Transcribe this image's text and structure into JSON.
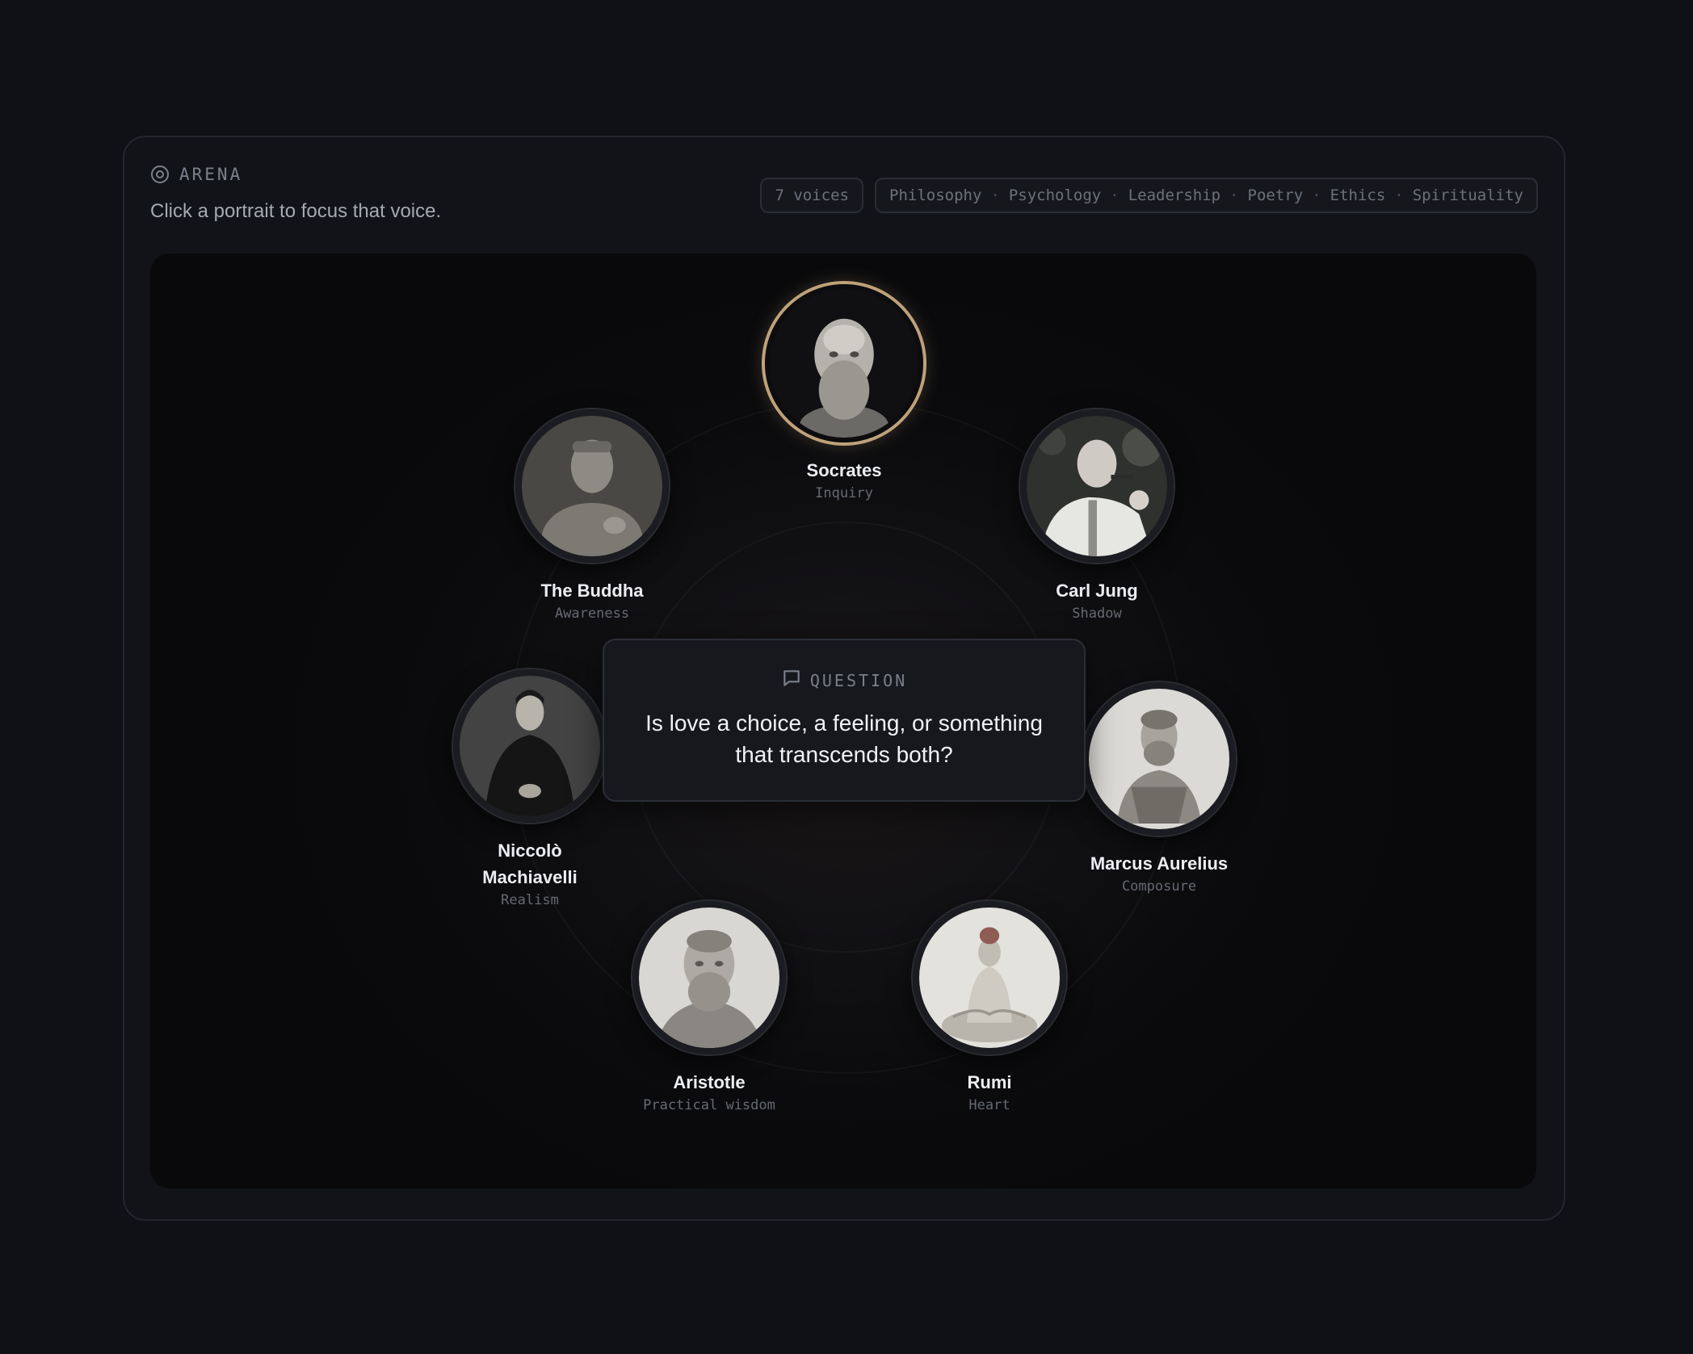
{
  "header": {
    "section_label": "ARENA",
    "subtitle": "Click a portrait to focus that voice.",
    "voice_count": "7 voices",
    "topics": [
      "Philosophy",
      "Psychology",
      "Leadership",
      "Poetry",
      "Ethics",
      "Spirituality"
    ]
  },
  "question": {
    "label": "QUESTION",
    "text": "Is love a choice, a feeling, or something that transcends both?"
  },
  "voices": [
    {
      "name": "Socrates",
      "trait": "Inquiry",
      "focused": true
    },
    {
      "name": "Carl Jung",
      "trait": "Shadow"
    },
    {
      "name": "Marcus Aurelius",
      "trait": "Composure"
    },
    {
      "name": "Rumi",
      "trait": "Heart"
    },
    {
      "name": "Aristotle",
      "trait": "Practical wisdom"
    },
    {
      "name": "Niccolò Machiavelli",
      "trait": "Realism"
    },
    {
      "name": "The Buddha",
      "trait": "Awareness"
    }
  ],
  "colors": {
    "page_bg": "#0f1116",
    "focus_ring": "#bfa27a",
    "text_primary": "#eceef1",
    "text_muted": "#656a73"
  },
  "icons": {
    "arena": "target-icon",
    "question": "chat-bubble-icon"
  }
}
